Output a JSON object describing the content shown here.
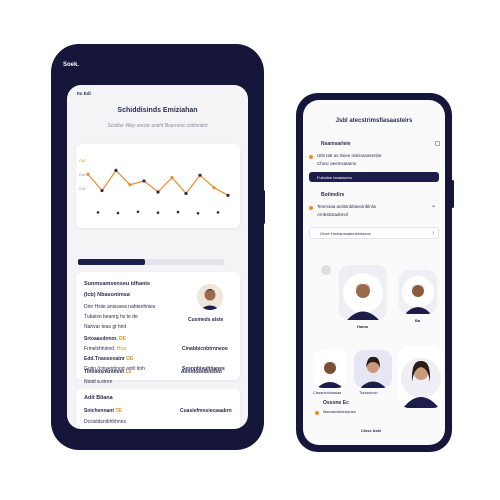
{
  "colors": {
    "accent": "#f08a24",
    "navy": "#1c1d48",
    "frame": "#15163a"
  },
  "phone1": {
    "topbar": "Soek.",
    "status": "Ito Edl",
    "title": "Schiddisinds Emiziahan",
    "subtitle": "Scoliter Wey asrcle aniiht Bserrene cotitsnitot",
    "chart_data": {
      "type": "line",
      "ytick_top": "CrE",
      "ytick_mid": "Cr6",
      "ytick_low": "Cr5",
      "values": [
        62,
        28,
        70,
        40,
        48,
        25,
        55,
        22,
        60,
        34,
        18
      ],
      "dots_below": [
        12,
        10,
        14,
        11,
        13,
        9,
        12
      ],
      "ylim": [
        0,
        100
      ]
    },
    "progress": 0.46,
    "profile": {
      "heading1": "Sunmsamsenseu idhanis",
      "heading2": "(Icb) Nbasonimsa",
      "lines": [
        "Dnir Hsiie anisssea nahtenhnies",
        "Tubaisn beanrg hs te de",
        "Nahvar teas gt hnit"
      ],
      "side_name": "Cusmeds alste",
      "rows": [
        {
          "a": "Srtoaasdnnor.",
          "b": "DE",
          "c": "Cinabbicnbtrnneoo"
        },
        {
          "a": "Frinelshhinnd.",
          "b": "Hoa"
        },
        {
          "a": "Edd.Tnaoseoatnr",
          "b": "DE",
          "c": "Sesnnbieuhbanes"
        },
        {
          "a": "Gutin (cinsenhnod anhl tinh"
        },
        {
          "a": "Tinniiosnkntmnn",
          "b": "Ls",
          "c": "Aenntoeeibnebtn"
        },
        {
          "a": "Niotd a.eirnn"
        }
      ]
    },
    "bottom": {
      "heading": "Adit Bliana",
      "rows": [
        {
          "a": "Snichennant",
          "b": "TE",
          "c": "Cuasiefmnsiecaaabrn"
        },
        {
          "a": "Dcsistdsnibhhhnns"
        }
      ]
    }
  },
  "phone2": {
    "title": "Jsbl atecstrimsfiasaasteirs",
    "section1": "Nsamsarleie",
    "s1_row": "Utle tatt as tisiee nisisrasasenbe",
    "s1_row2": "Chnsr aeemsatamn",
    "dark_pill": "Fubsitse tanassnea",
    "section2": "Botimdirs",
    "s2_row": "Tesrnsaa antitsnbbtasnnblnlis",
    "s2_row2": "Ambsbstadnnnl",
    "field": "Gnee Honianesatnnbhdseoc",
    "caption1": "Hama",
    "caption2": "Ba",
    "people": [
      "Cissaneuhoasaa",
      "Tbnissfnan"
    ],
    "footer": "Ossone Ec",
    "footer_sub": "Iitsnasbdintnssnsn",
    "footer_label": "Cisse Aste"
  }
}
